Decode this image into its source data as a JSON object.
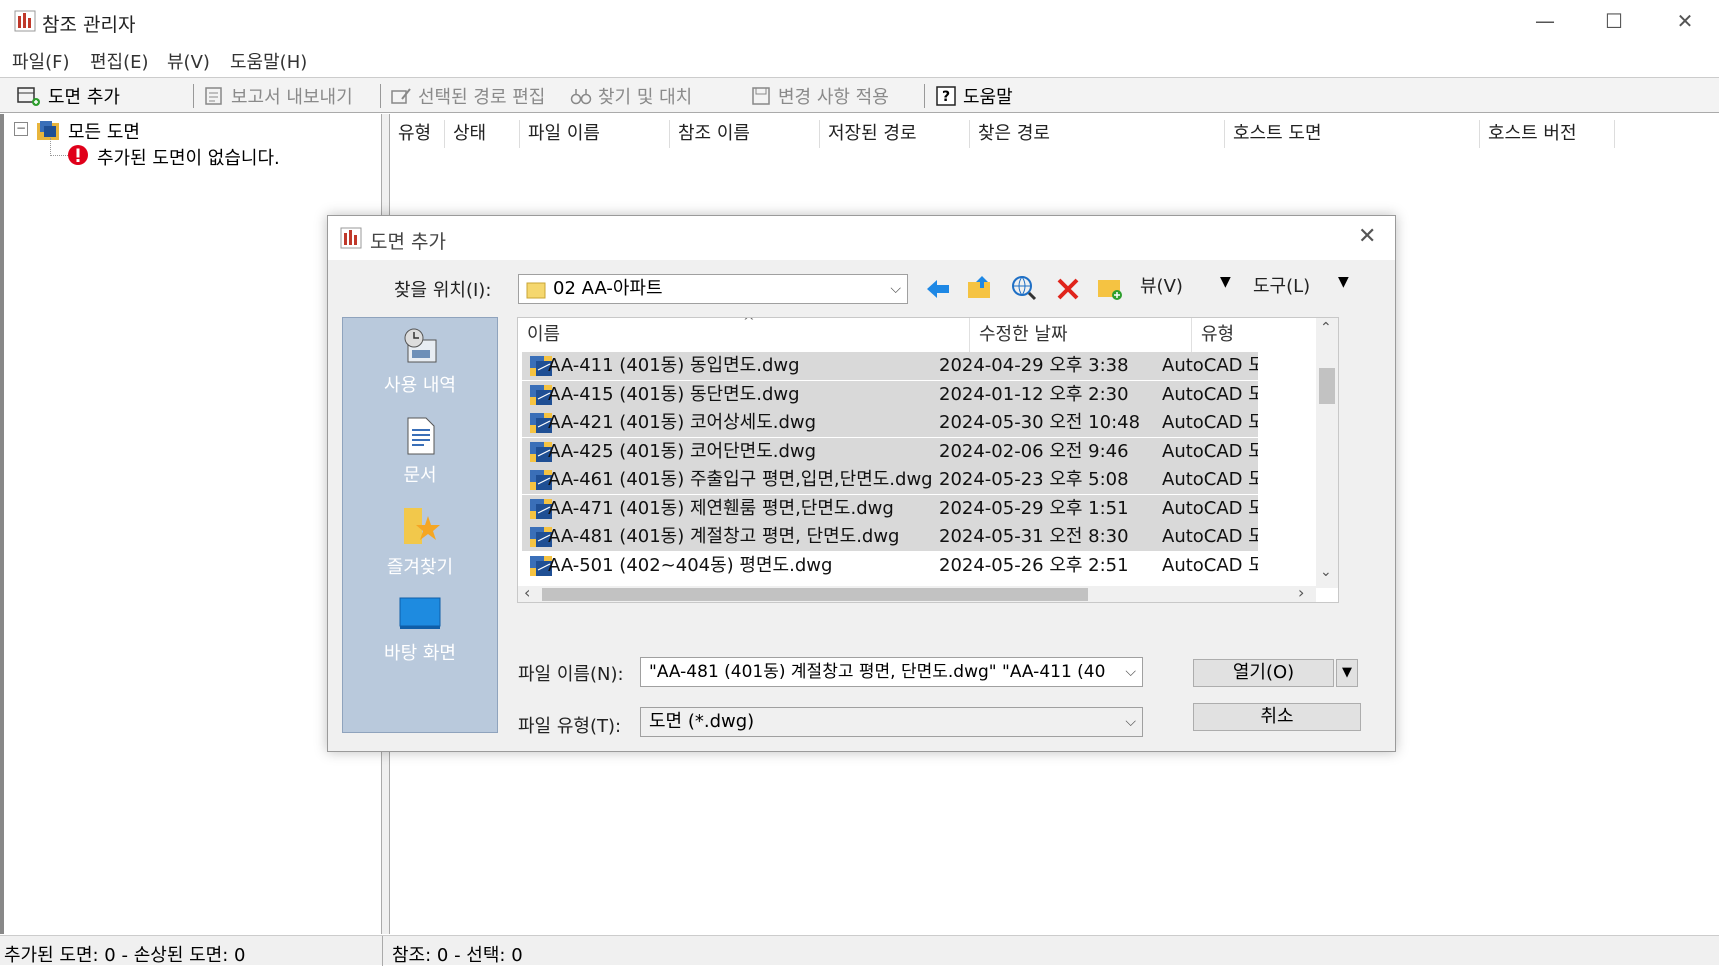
{
  "window": {
    "title": "참조 관리자",
    "minimize": "—",
    "maximize": "☐",
    "close": "✕"
  },
  "menu": [
    "파일(F)",
    "편집(E)",
    "뷰(V)",
    "도움말(H)"
  ],
  "toolbar": {
    "add_drawing": "도면 추가",
    "export_report": "보고서 내보내기",
    "edit_selected_path": "선택된 경로 편집",
    "find_replace": "찾기 및 대치",
    "apply_changes": "변경 사항 적용",
    "help": "도움말"
  },
  "tree": {
    "root": "모든 도면",
    "empty_message": "추가된 도면이 없습니다."
  },
  "columns": [
    "유형",
    "상태",
    "파일 이름",
    "참조 이름",
    "저장된 경로",
    "찾은 경로",
    "호스트 도면",
    "호스트 버전"
  ],
  "status": {
    "left": "추가된 도면: 0  -  손상된 도면: 0",
    "right": "참조: 0  -  선택: 0"
  },
  "dialog": {
    "title": "도면 추가",
    "look_in_label": "찾을 위치(I):",
    "look_in_value": "02 AA-아파트",
    "views_label": "뷰(V)",
    "tools_label": "도구(L)",
    "places": [
      "사용 내역",
      "문서",
      "즐겨찾기",
      "바탕 화면"
    ],
    "file_headers": [
      "이름",
      "수정한 날짜",
      "유형"
    ],
    "files": [
      {
        "name": "AA-411 (401동) 동입면도.dwg",
        "date": "2024-04-29 오후 3:38",
        "type": "AutoCAD 도",
        "selected": true
      },
      {
        "name": "AA-415 (401동) 동단면도.dwg",
        "date": "2024-01-12 오후 2:30",
        "type": "AutoCAD 도",
        "selected": true
      },
      {
        "name": "AA-421 (401동) 코어상세도.dwg",
        "date": "2024-05-30 오전 10:48",
        "type": "AutoCAD 도",
        "selected": true
      },
      {
        "name": "AA-425 (401동) 코어단면도.dwg",
        "date": "2024-02-06 오전 9:46",
        "type": "AutoCAD 도",
        "selected": true
      },
      {
        "name": "AA-461 (401동) 주출입구 평면,입면,단면도.dwg",
        "date": "2024-05-23 오후 5:08",
        "type": "AutoCAD 도",
        "selected": true
      },
      {
        "name": "AA-471 (401동) 제연휀룸 평면,단면도.dwg",
        "date": "2024-05-29 오후 1:51",
        "type": "AutoCAD 도",
        "selected": true
      },
      {
        "name": "AA-481 (401동) 계절창고 평면, 단면도.dwg",
        "date": "2024-05-31 오전 8:30",
        "type": "AutoCAD 도",
        "selected": true
      },
      {
        "name": "AA-501 (402~404동) 평면도.dwg",
        "date": "2024-05-26 오후 2:51",
        "type": "AutoCAD 도",
        "selected": false
      }
    ],
    "filename_label": "파일 이름(N):",
    "filename_value": "\"AA-481 (401동) 계절창고 평면, 단면도.dwg\" \"AA-411 (40",
    "filetype_label": "파일 유형(T):",
    "filetype_value": "도면  (*.dwg)",
    "open_button": "열기(O)",
    "cancel_button": "취소"
  }
}
